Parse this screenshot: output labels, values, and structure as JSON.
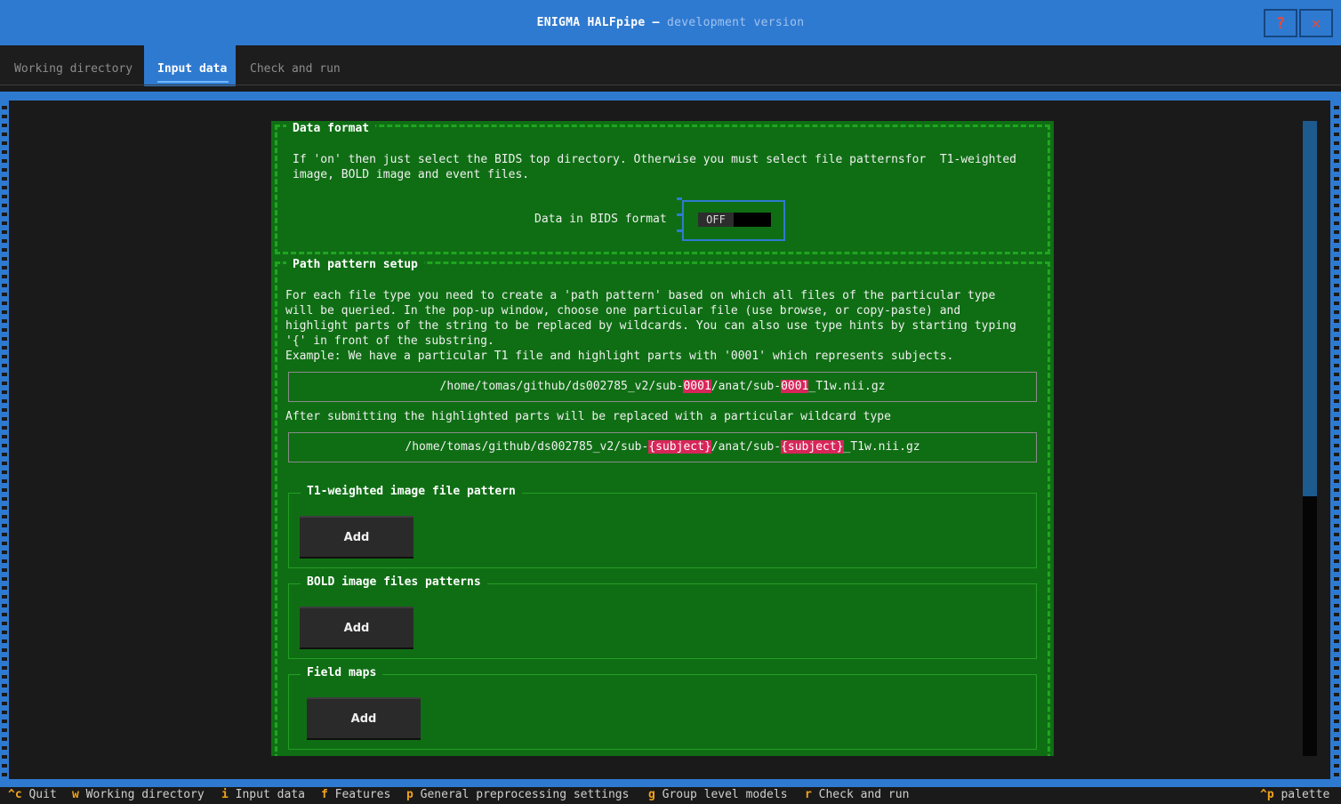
{
  "window": {
    "title": "ENIGMA HALFpipe",
    "separator": "—",
    "subtitle": "development version",
    "help_label": "?",
    "close_label": "✕"
  },
  "tabs": [
    {
      "label": "Working directory",
      "active": false
    },
    {
      "label": "Input data",
      "active": true
    },
    {
      "label": "Check and run",
      "active": false
    }
  ],
  "data_format": {
    "legend": "Data format",
    "description": "If 'on' then just select the BIDS top directory. Otherwise you must select file patternsfor  T1-weighted\nimage, BOLD image and event files.",
    "toggle_label": "Data in BIDS format",
    "toggle_value": "OFF"
  },
  "path_pattern": {
    "legend": "Path pattern setup",
    "description": "For each file type you need to create a 'path pattern' based on which all files of the particular type\nwill be queried. In the pop-up window, choose one particular file (use browse, or copy-paste) and\nhighlight parts of the string to be replaced by wildcards. You can also use type hints by starting typing\n'{' in front of the substring.\nExample: We have a particular T1 file and highlight parts with '0001' which represents subjects.",
    "example1": {
      "part1": "/home/tomas/github/ds002785_v2/sub-",
      "hl1": "0001",
      "part2": "/anat/sub-",
      "hl2": "0001",
      "part3": "_T1w.nii.gz"
    },
    "after_text": "After submitting the highlighted parts will be replaced with a particular wildcard type",
    "example2": {
      "part1": "/home/tomas/github/ds002785_v2/sub-",
      "hl1": "{subject}",
      "part2": "/anat/sub-",
      "hl2": "{subject}",
      "part3": "_T1w.nii.gz"
    },
    "t1": {
      "legend": "T1-weighted image file pattern",
      "button": "Add"
    },
    "bold": {
      "legend": "BOLD image files patterns",
      "button": "Add"
    },
    "fieldmaps": {
      "legend": "Field maps",
      "button": "Add"
    }
  },
  "footer": [
    {
      "key": "^c",
      "label": "Quit"
    },
    {
      "key": "w",
      "label": "Working directory"
    },
    {
      "key": "i",
      "label": "Input data"
    },
    {
      "key": "f",
      "label": "Features"
    },
    {
      "key": "p",
      "label": "General preprocessing settings"
    },
    {
      "key": "g",
      "label": "Group level models"
    },
    {
      "key": "r",
      "label": "Check and run"
    },
    {
      "key": "^p",
      "label": "palette"
    }
  ],
  "colors": {
    "accent_blue": "#2f7ad1",
    "content_green": "#0f6e14",
    "highlight_pink": "#d7265a",
    "footer_key_orange": "#f2a31b"
  }
}
